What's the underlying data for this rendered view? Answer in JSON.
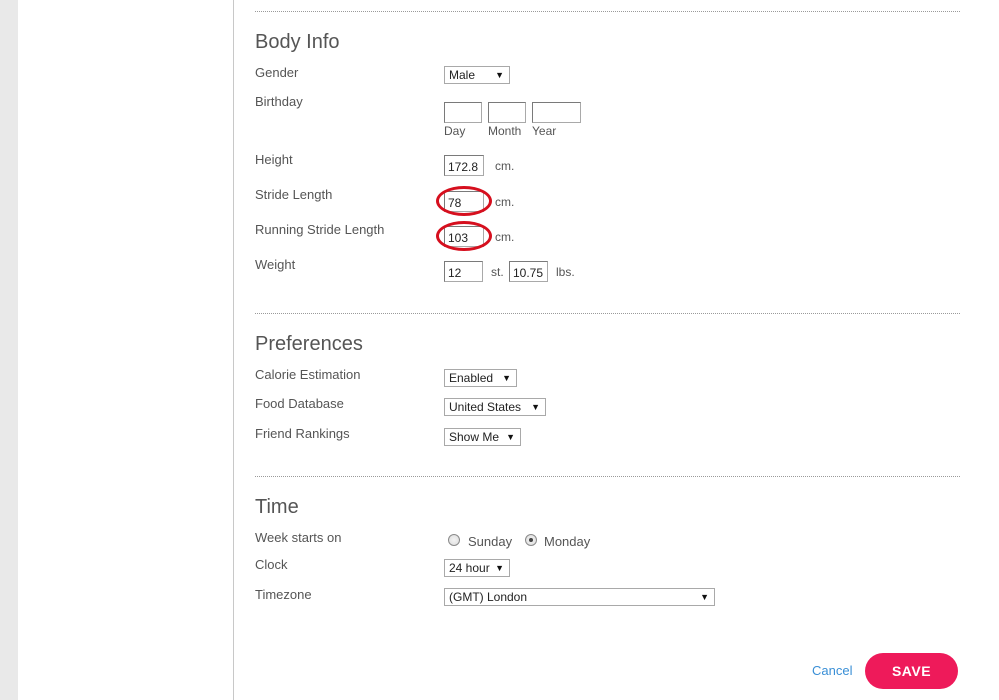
{
  "body_info": {
    "title": "Body Info",
    "gender": {
      "label": "Gender",
      "value": "Male"
    },
    "birthday": {
      "label": "Birthday",
      "day_label": "Day",
      "month_label": "Month",
      "year_label": "Year",
      "day": "",
      "month": "",
      "year": ""
    },
    "height": {
      "label": "Height",
      "value": "172.8",
      "unit": "cm."
    },
    "stride": {
      "label": "Stride Length",
      "value": "78",
      "unit": "cm."
    },
    "running_stride": {
      "label": "Running Stride Length",
      "value": "103",
      "unit": "cm."
    },
    "weight": {
      "label": "Weight",
      "stones": "12",
      "stones_unit": "st.",
      "lbs": "10.75",
      "lbs_unit": "lbs."
    }
  },
  "preferences": {
    "title": "Preferences",
    "calorie": {
      "label": "Calorie Estimation",
      "value": "Enabled"
    },
    "food_db": {
      "label": "Food Database",
      "value": "United States"
    },
    "friend_rankings": {
      "label": "Friend Rankings",
      "value": "Show Me"
    }
  },
  "time": {
    "title": "Time",
    "week_start": {
      "label": "Week starts on",
      "option_sunday": "Sunday",
      "option_monday": "Monday",
      "selected": "Monday"
    },
    "clock": {
      "label": "Clock",
      "value": "24 hour"
    },
    "timezone": {
      "label": "Timezone",
      "value": "(GMT) London"
    }
  },
  "actions": {
    "cancel": "Cancel",
    "save": "SAVE"
  },
  "colors": {
    "save_button": "#ee1a5a",
    "cancel_link": "#3a8fd6",
    "annotation_circle": "#d60f1e"
  },
  "icons": {
    "select_arrow": "dropdown-arrow-icon"
  }
}
